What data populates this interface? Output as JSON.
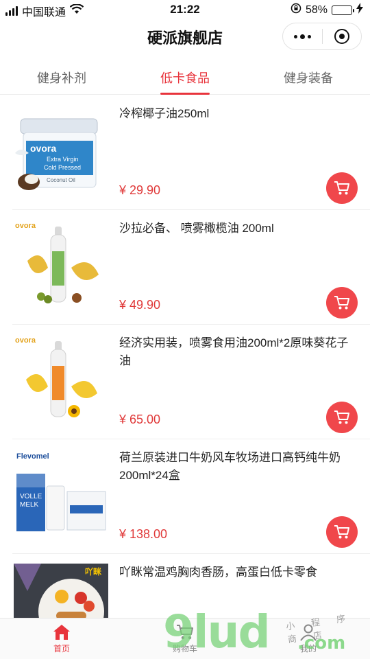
{
  "status_bar": {
    "carrier": "中国联通",
    "time": "21:22",
    "battery_percent": "58%",
    "battery_level": 0.58,
    "icons": [
      "signal-icon",
      "wifi-icon",
      "orientation-lock-icon",
      "battery-icon",
      "charging-icon"
    ]
  },
  "nav": {
    "title": "硬派旗舰店",
    "capsule_icons": [
      "more-icon",
      "close-miniprogram-icon"
    ]
  },
  "tabs": [
    {
      "label": "健身补剂",
      "active": false
    },
    {
      "label": "低卡食品",
      "active": true
    },
    {
      "label": "健身装备",
      "active": false
    }
  ],
  "products": [
    {
      "name": "冷榨椰子油250ml",
      "price": "¥ 29.90"
    },
    {
      "name": "沙拉必备、 喷雾橄榄油 200ml",
      "price": "¥ 49.90"
    },
    {
      "name": "经济实用装，喷雾食用油200ml*2原味葵花子油",
      "price": "¥ 65.00"
    },
    {
      "name": "荷兰原装进口牛奶风车牧场进口高钙纯牛奶200ml*24盒",
      "price": "¥ 138.00"
    },
    {
      "name": "吖眯常温鸡胸肉香肠，高蛋白低卡零食",
      "price": ""
    }
  ],
  "product_images": {
    "p1_brand": "ovora",
    "p1_line1": "Extra Virgin",
    "p1_line2": "Cold Pressed",
    "p1_line3": "Coconut Oil",
    "p2_brand": "ovora",
    "p3_brand": "ovora",
    "p4_brand": "Flevomel",
    "p4_box_line1": "VOLLE",
    "p4_box_line2": "MELK",
    "p5_brand": "吖眯"
  },
  "bottom_tabs": [
    {
      "label": "首页",
      "icon": "home-icon",
      "active": true
    },
    {
      "label": "购物车",
      "icon": "cart-icon",
      "active": false
    },
    {
      "label": "我的",
      "icon": "user-icon",
      "active": false
    }
  ],
  "watermark": {
    "big": "9lud",
    "com": ".com",
    "small": "小 程 序 商 店"
  },
  "colors": {
    "accent": "#e8343c",
    "price": "#e03a3a",
    "cart_button": "#f0474b"
  }
}
